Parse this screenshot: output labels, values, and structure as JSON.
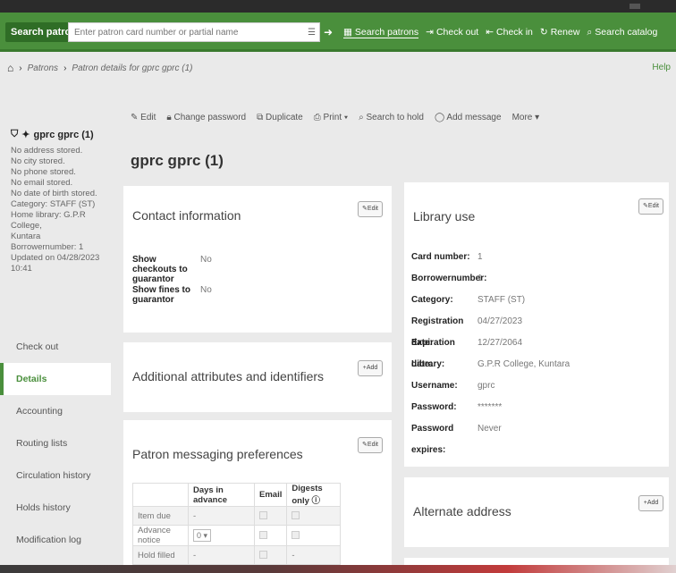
{
  "header": {
    "search_label": "Search patrons",
    "search_placeholder": "Enter patron card number or partial name",
    "links": [
      {
        "icon": "patrons-icon",
        "glyph": "▦",
        "label": "Search patrons"
      },
      {
        "icon": "checkout-icon",
        "glyph": "⇥",
        "label": "Check out"
      },
      {
        "icon": "checkin-icon",
        "glyph": "⇤",
        "label": "Check in"
      },
      {
        "icon": "renew-icon",
        "glyph": "↻",
        "label": "Renew"
      },
      {
        "icon": "search-icon",
        "glyph": "⌕",
        "label": "Search catalog"
      }
    ]
  },
  "breadcrumb": {
    "items": [
      "Patrons",
      "Patron details for gprc gprc (1)"
    ],
    "help": "Help"
  },
  "patron_card": {
    "name": "gprc gprc (1)",
    "lines": [
      "No address stored.",
      "No city stored.",
      "No phone stored.",
      "No email stored.",
      "No date of birth stored.",
      "Category: STAFF (ST)",
      "Home library: G.P.R College,",
      "Kuntara",
      "Borrowernumber: 1",
      "Updated on 04/28/2023 10:41"
    ]
  },
  "nav": [
    "Check out",
    "Details",
    "Accounting",
    "Routing lists",
    "Circulation history",
    "Holds history",
    "Modification log"
  ],
  "toolbar": [
    "Edit",
    "Change password",
    "Duplicate",
    "Print ▾",
    "Search to hold",
    "Add message",
    "More ▾"
  ],
  "page_title": "gprc gprc (1)",
  "contact": {
    "title": "Contact information",
    "edit": "Edit",
    "rows": [
      {
        "label": "Show checkouts to guarantor",
        "value": "No"
      },
      {
        "label": "Show fines to guarantor",
        "value": "No"
      }
    ]
  },
  "additional": {
    "title": "Additional attributes and identifiers",
    "add": "Add"
  },
  "messaging": {
    "title": "Patron messaging preferences",
    "edit": "Edit",
    "headers": [
      "",
      "Days in advance",
      "Email",
      "Digests only"
    ],
    "rows": [
      {
        "name": "Item due",
        "days": "-",
        "digest": "-"
      },
      {
        "name": "Advance notice",
        "days": "0",
        "digest": ""
      },
      {
        "name": "Hold filled",
        "days": "-",
        "digest": "-"
      }
    ]
  },
  "library": {
    "title": "Library use",
    "edit": "Edit",
    "rows": [
      {
        "label": "Card number:",
        "value": "1"
      },
      {
        "label": "Borrowernumber:",
        "value": "1"
      },
      {
        "label": "Category:",
        "value": "STAFF (ST)"
      },
      {
        "label": "Registration date:",
        "value": "04/27/2023"
      },
      {
        "label": "Expiration date:",
        "value": "12/27/2064"
      },
      {
        "label": "Library:",
        "value": "G.P.R College, Kuntara"
      },
      {
        "label": "Username:",
        "value": "gprc"
      },
      {
        "label": "Password:",
        "value": "*******"
      },
      {
        "label": "Password expires:",
        "value": "Never"
      }
    ]
  },
  "alternate": {
    "title": "Alternate address",
    "add": "Add"
  }
}
